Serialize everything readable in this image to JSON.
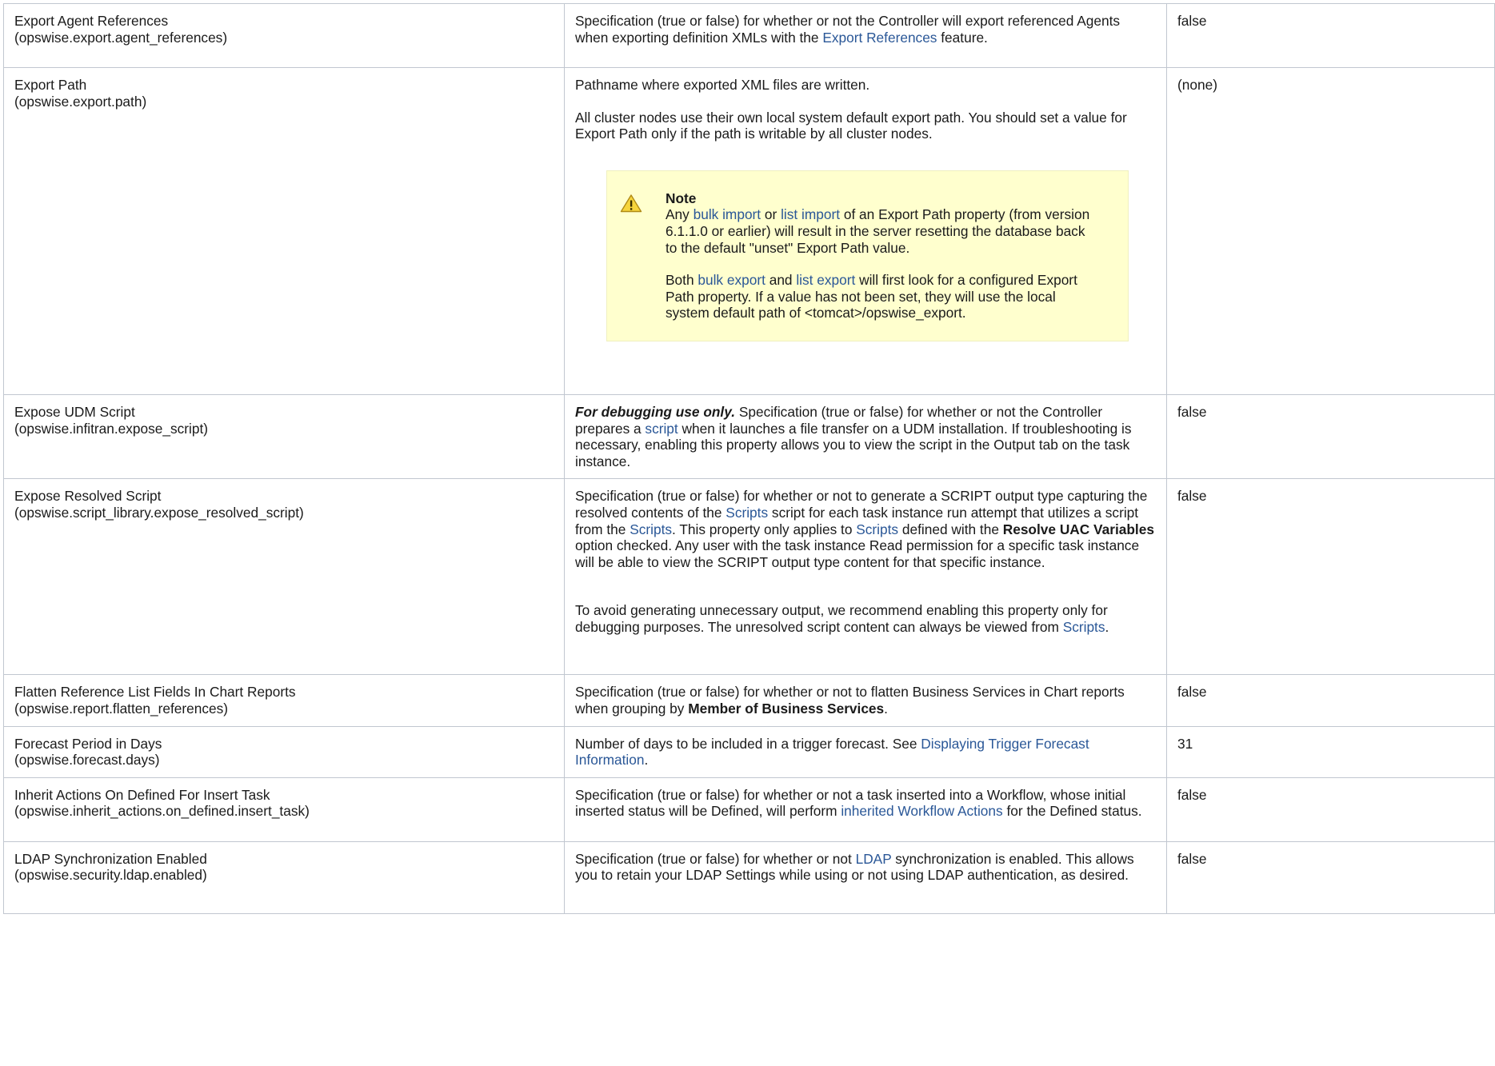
{
  "rows": [
    {
      "name": "Export Agent References",
      "prop": "(opswise.export.agent_references)",
      "default": "false",
      "desc_parts": [
        {
          "t": "Specification (true or false) for whether or not the Controller will export referenced Agents when exporting definition XMLs with the "
        },
        {
          "t": "Export References",
          "link": true
        },
        {
          "t": " feature."
        }
      ]
    },
    {
      "name": "Export Path",
      "prop": "(opswise.export.path)",
      "default": "(none)",
      "para1": "Pathname where exported XML files are written.",
      "para2": "All cluster nodes use their own local system default export path. You should set a value for Export Path only if the path is writable by all cluster nodes.",
      "note": {
        "title": "Note",
        "icon": "warning-icon",
        "p1_a": "Any ",
        "p1_link1": "bulk import",
        "p1_b": " or ",
        "p1_link2": "list import",
        "p1_c": " of an Export Path property (from version 6.1.1.0 or earlier) will result in the server resetting the database back to the default \"unset\" Export Path value.",
        "p2_a": "Both ",
        "p2_link1": "bulk export",
        "p2_b": " and ",
        "p2_link2": "list export",
        "p2_c": " will first look for a configured Export Path property. If a value has not been set, they will use the local system default path of <tomcat>/opswise_export."
      }
    },
    {
      "name": "Expose UDM Script",
      "prop": "(opswise.infitran.expose_script)",
      "default": "false",
      "lead": "For debugging use only.",
      "d_a": " Specification (true or false) for whether or not the Controller prepares a ",
      "d_link": "script",
      "d_b": " when it launches a file transfer on a UDM installation. If troubleshooting is necessary, enabling this property allows you to view the script in the Output tab on the task instance."
    },
    {
      "name": "Expose Resolved Script",
      "prop": "(opswise.script_library.expose_resolved_script)",
      "default": "false",
      "p1_a": "Specification (true or false) for whether or not to generate a SCRIPT output type capturing the resolved contents of the ",
      "p1_link1": "Scripts",
      "p1_b": " script for each task instance run attempt that utilizes a script from the ",
      "p1_link2": "Scripts",
      "p1_c": ". This property only applies to ",
      "p1_link3": "Scripts",
      "p1_d": " defined with the ",
      "p1_bold": "Resolve UAC Variables",
      "p1_e": " option checked. Any user with the task instance Read permission for a specific task instance will be able to view the SCRIPT output type content for that specific instance.",
      "p2_a": "To avoid generating unnecessary output, we recommend enabling this property only for debugging purposes. The unresolved script content can always be viewed from ",
      "p2_link": "Scripts",
      "p2_b": "."
    },
    {
      "name": "Flatten Reference List Fields In Chart Reports",
      "prop": "(opswise.report.flatten_references)",
      "default": "false",
      "d_a": "Specification (true or false) for whether or not to flatten Business Services in Chart reports when grouping by ",
      "d_bold": "Member of Business Services",
      "d_b": "."
    },
    {
      "name": "Forecast Period in Days",
      "prop": "(opswise.forecast.days)",
      "default": "31",
      "d_a": "Number of days to be included in a trigger forecast. See ",
      "d_link": "Displaying Trigger Forecast Information",
      "d_b": "."
    },
    {
      "name": "Inherit Actions On Defined For Insert Task",
      "prop": "(opswise.inherit_actions.on_defined.insert_task)",
      "default": "false",
      "d_a": "Specification (true or false) for whether or not a task inserted into a Workflow, whose initial inserted status will be Defined, will perform ",
      "d_link": "inherited Workflow Actions",
      "d_b": " for the Defined status."
    },
    {
      "name": "LDAP Synchronization Enabled",
      "prop": "(opswise.security.ldap.enabled)",
      "default": "false",
      "d_a": "Specification (true or false) for whether or not ",
      "d_link": "LDAP",
      "d_b": " synchronization is enabled. This allows you to retain your LDAP Settings while using or not using LDAP authentication, as desired."
    }
  ],
  "colors": {
    "link": "#2a5797",
    "note_bg": "#ffffce",
    "border": "#c1c7d0",
    "warning_fill": "#f6d53d"
  }
}
